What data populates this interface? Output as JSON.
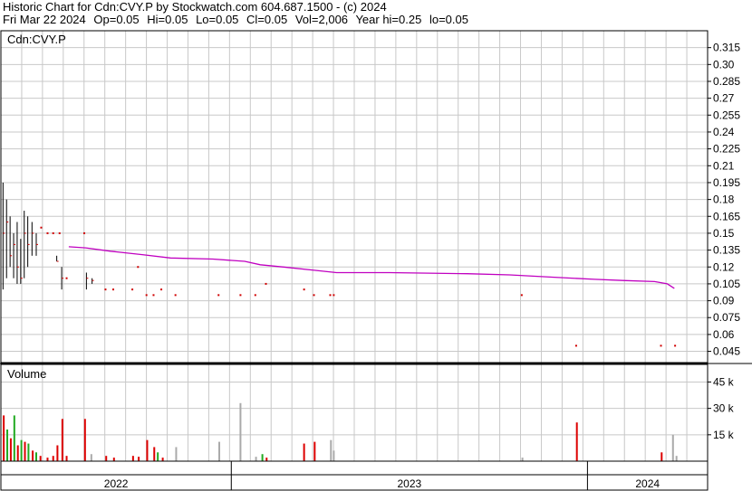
{
  "header": {
    "line1": "Historic Chart for Cdn:CVY.P by Stockwatch.com 604.687.1500 - (c) 2024",
    "date": "Fri Mar 22 2024",
    "open": "Op=0.05",
    "high": "Hi=0.05",
    "low": "Lo=0.05",
    "close": "Cl=0.05",
    "volume": "Vol=2,006",
    "year_high": "Year hi=0.25",
    "year_low": "lo=0.05"
  },
  "chart_data": [
    {
      "type": "line",
      "title": "Cdn:CVY.P",
      "ylim": [
        0.035,
        0.33
      ],
      "y_ticks": [
        0.315,
        0.3,
        0.285,
        0.27,
        0.255,
        0.24,
        0.225,
        0.21,
        0.195,
        0.18,
        0.165,
        0.15,
        0.135,
        0.12,
        0.105,
        0.09,
        0.075,
        0.06,
        0.045
      ],
      "y_tick_labels": [
        "0.315",
        "0.30",
        "0.285",
        "0.27",
        "0.255",
        "0.24",
        "0.225",
        "0.21",
        "0.195",
        "0.18",
        "0.165",
        "0.15",
        "0.135",
        "0.12",
        "0.105",
        "0.09",
        "0.075",
        "0.06",
        "0.045"
      ],
      "grid": true,
      "x_range": [
        0,
        100
      ],
      "ohlc_bars": [
        {
          "x": 0.3,
          "high": 0.195,
          "low": 0.1,
          "close": 0.15,
          "color": "black"
        },
        {
          "x": 0.8,
          "high": 0.18,
          "low": 0.11,
          "close": 0.16,
          "color": "black"
        },
        {
          "x": 1.3,
          "high": 0.165,
          "low": 0.12,
          "close": 0.13,
          "color": "black"
        },
        {
          "x": 1.8,
          "high": 0.15,
          "low": 0.11,
          "close": 0.14,
          "color": "black"
        },
        {
          "x": 2.3,
          "high": 0.16,
          "low": 0.105,
          "close": 0.12,
          "color": "black"
        },
        {
          "x": 2.8,
          "high": 0.145,
          "low": 0.105,
          "close": 0.11,
          "color": "black"
        },
        {
          "x": 3.3,
          "high": 0.17,
          "low": 0.11,
          "close": 0.15,
          "color": "black"
        },
        {
          "x": 3.8,
          "high": 0.165,
          "low": 0.12,
          "close": 0.14,
          "color": "black"
        },
        {
          "x": 4.4,
          "high": 0.16,
          "low": 0.13,
          "close": 0.15,
          "color": "black"
        },
        {
          "x": 5.0,
          "high": 0.15,
          "low": 0.13,
          "close": 0.14,
          "color": "black"
        },
        {
          "x": 7.9,
          "high": 0.13,
          "low": 0.125,
          "close": 0.125,
          "color": "black"
        },
        {
          "x": 8.6,
          "high": 0.12,
          "low": 0.1,
          "close": 0.11,
          "color": "black"
        },
        {
          "x": 12.1,
          "high": 0.115,
          "low": 0.1,
          "close": 0.11,
          "color": "black"
        },
        {
          "x": 12.9,
          "high": 0.11,
          "low": 0.105,
          "close": 0.108,
          "color": "black"
        }
      ],
      "price_points": [
        {
          "x": 5.7,
          "y": 0.155
        },
        {
          "x": 6.6,
          "y": 0.15
        },
        {
          "x": 7.4,
          "y": 0.15
        },
        {
          "x": 8.3,
          "y": 0.15
        },
        {
          "x": 9.3,
          "y": 0.11
        },
        {
          "x": 11.8,
          "y": 0.15
        },
        {
          "x": 14.8,
          "y": 0.1
        },
        {
          "x": 15.9,
          "y": 0.1
        },
        {
          "x": 18.6,
          "y": 0.1
        },
        {
          "x": 19.4,
          "y": 0.12
        },
        {
          "x": 20.6,
          "y": 0.095
        },
        {
          "x": 21.6,
          "y": 0.095
        },
        {
          "x": 22.7,
          "y": 0.1
        },
        {
          "x": 24.7,
          "y": 0.095
        },
        {
          "x": 30.8,
          "y": 0.095
        },
        {
          "x": 33.9,
          "y": 0.095
        },
        {
          "x": 36.0,
          "y": 0.095
        },
        {
          "x": 37.5,
          "y": 0.105
        },
        {
          "x": 42.9,
          "y": 0.1
        },
        {
          "x": 44.3,
          "y": 0.095
        },
        {
          "x": 46.6,
          "y": 0.095
        },
        {
          "x": 47.1,
          "y": 0.095
        },
        {
          "x": 73.7,
          "y": 0.095
        },
        {
          "x": 81.4,
          "y": 0.05
        },
        {
          "x": 93.4,
          "y": 0.05
        },
        {
          "x": 95.4,
          "y": 0.05
        }
      ],
      "moving_average": [
        {
          "x": 9.6,
          "y": 0.138
        },
        {
          "x": 12.0,
          "y": 0.137
        },
        {
          "x": 15.5,
          "y": 0.134
        },
        {
          "x": 20.0,
          "y": 0.131
        },
        {
          "x": 24.0,
          "y": 0.128
        },
        {
          "x": 30.0,
          "y": 0.127
        },
        {
          "x": 34.5,
          "y": 0.125
        },
        {
          "x": 36.7,
          "y": 0.122
        },
        {
          "x": 40.0,
          "y": 0.12
        },
        {
          "x": 44.5,
          "y": 0.117
        },
        {
          "x": 47.5,
          "y": 0.115
        },
        {
          "x": 55.0,
          "y": 0.115
        },
        {
          "x": 66.0,
          "y": 0.114
        },
        {
          "x": 72.0,
          "y": 0.113
        },
        {
          "x": 78.0,
          "y": 0.111
        },
        {
          "x": 84.0,
          "y": 0.109
        },
        {
          "x": 88.0,
          "y": 0.108
        },
        {
          "x": 92.5,
          "y": 0.107
        },
        {
          "x": 94.3,
          "y": 0.105
        },
        {
          "x": 95.3,
          "y": 0.101
        }
      ],
      "colors": {
        "price": "#000000",
        "point": "#d00000",
        "average": "#c000c0",
        "grid": "#c8c8c8"
      }
    },
    {
      "type": "bar",
      "title": "Volume",
      "ylim": [
        0,
        55000
      ],
      "y_ticks": [
        15000,
        30000,
        45000
      ],
      "y_tick_labels": [
        "15 k",
        "30 k",
        "45 k"
      ],
      "x_range": [
        0,
        100
      ],
      "bars": [
        {
          "x": 0.4,
          "value": 26000,
          "color": "red"
        },
        {
          "x": 0.9,
          "value": 18000,
          "color": "green"
        },
        {
          "x": 1.4,
          "value": 13000,
          "color": "red"
        },
        {
          "x": 1.9,
          "value": 26000,
          "color": "green"
        },
        {
          "x": 2.4,
          "value": 9000,
          "color": "red"
        },
        {
          "x": 2.9,
          "value": 12000,
          "color": "green"
        },
        {
          "x": 3.4,
          "value": 11000,
          "color": "red"
        },
        {
          "x": 3.9,
          "value": 10000,
          "color": "green"
        },
        {
          "x": 4.5,
          "value": 6000,
          "color": "red"
        },
        {
          "x": 5.0,
          "value": 5000,
          "color": "green"
        },
        {
          "x": 5.6,
          "value": 3000,
          "color": "red"
        },
        {
          "x": 6.6,
          "value": 2000,
          "color": "red"
        },
        {
          "x": 7.4,
          "value": 3000,
          "color": "red"
        },
        {
          "x": 8.0,
          "value": 9000,
          "color": "red"
        },
        {
          "x": 8.7,
          "value": 24000,
          "color": "red"
        },
        {
          "x": 9.3,
          "value": 3000,
          "color": "red"
        },
        {
          "x": 11.9,
          "value": 24000,
          "color": "red"
        },
        {
          "x": 12.8,
          "value": 4000,
          "color": "gray"
        },
        {
          "x": 14.9,
          "value": 3000,
          "color": "red"
        },
        {
          "x": 16.0,
          "value": 2000,
          "color": "red"
        },
        {
          "x": 18.7,
          "value": 3000,
          "color": "red"
        },
        {
          "x": 19.5,
          "value": 2500,
          "color": "red"
        },
        {
          "x": 20.7,
          "value": 12000,
          "color": "red"
        },
        {
          "x": 21.7,
          "value": 8000,
          "color": "red"
        },
        {
          "x": 22.2,
          "value": 5000,
          "color": "green"
        },
        {
          "x": 22.9,
          "value": 2000,
          "color": "red"
        },
        {
          "x": 24.8,
          "value": 8000,
          "color": "gray"
        },
        {
          "x": 30.9,
          "value": 11000,
          "color": "gray"
        },
        {
          "x": 33.9,
          "value": 33000,
          "color": "gray"
        },
        {
          "x": 36.1,
          "value": 2500,
          "color": "gray"
        },
        {
          "x": 37.0,
          "value": 4000,
          "color": "green"
        },
        {
          "x": 37.6,
          "value": 2000,
          "color": "red"
        },
        {
          "x": 42.9,
          "value": 10000,
          "color": "red"
        },
        {
          "x": 44.4,
          "value": 11000,
          "color": "red"
        },
        {
          "x": 46.7,
          "value": 12000,
          "color": "gray"
        },
        {
          "x": 47.1,
          "value": 6000,
          "color": "gray"
        },
        {
          "x": 73.8,
          "value": 2000,
          "color": "gray"
        },
        {
          "x": 81.5,
          "value": 22000,
          "color": "red"
        },
        {
          "x": 93.5,
          "value": 5000,
          "color": "red"
        },
        {
          "x": 95.1,
          "value": 15000,
          "color": "gray"
        },
        {
          "x": 95.6,
          "value": 3000,
          "color": "gray"
        }
      ],
      "colors": {
        "red": "#dd0000",
        "green": "#22aa22",
        "gray": "#aaaaaa"
      }
    }
  ],
  "x_axis": {
    "labels": [
      {
        "text": "2022",
        "start": 0,
        "end": 32.6
      },
      {
        "text": "2023",
        "start": 32.6,
        "end": 83.0
      },
      {
        "text": "2024",
        "start": 83.0,
        "end": 100
      }
    ]
  }
}
